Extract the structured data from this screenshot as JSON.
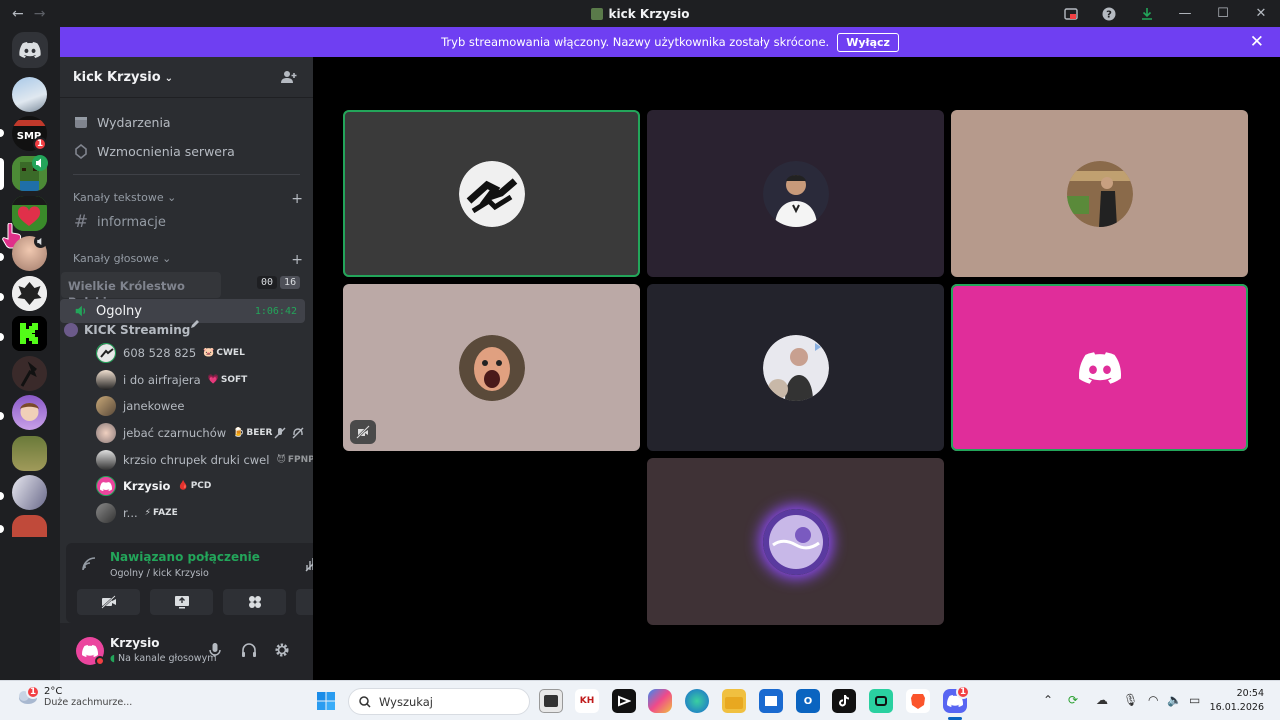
{
  "window": {
    "title": "kick Krzysio"
  },
  "banner": {
    "text": "Tryb streamowania włączony. Nazwy użytkownika zostały skrócone.",
    "button": "Wyłącz"
  },
  "rail": {
    "badges": [
      "1"
    ]
  },
  "server": {
    "name": "kick Krzysio",
    "menu": [
      "Wydarzenia",
      "Wzmocnienia serwera"
    ],
    "text_category": "Kanały tekstowe",
    "text_channels": [
      "informacje"
    ],
    "voice_category": "Kanały głosowe",
    "drag_ghost_title": "Wielkie Królestwo Polskie",
    "drag_ghost_subtitle": "KICK Streaming",
    "counter_a": "00",
    "counter_b": "16",
    "voice_channel": {
      "name": "Ogolny",
      "time": "1:06:42"
    },
    "voice_users": [
      {
        "name": "608 528 825",
        "tag": "CWEL",
        "tag_icon": "🐷"
      },
      {
        "name": "i do airfrajera",
        "tag": "SOFT",
        "tag_icon": "💗"
      },
      {
        "name": "janekowee",
        "tag": "",
        "tag_icon": ""
      },
      {
        "name": "jebać czarnuchów",
        "tag": "BEER",
        "tag_icon": "🍺"
      },
      {
        "name": "krzsio chrupek druki cwel",
        "tag": "FPNP",
        "tag_icon": "😈"
      },
      {
        "name": "Krzysio",
        "tag": "PCD",
        "tag_icon": "🩸"
      },
      {
        "name": "r...",
        "tag": "FAZE",
        "tag_icon": "⚡"
      }
    ]
  },
  "voice_panel": {
    "status": "Nawiązano połączenie",
    "location": "Ogolny / kick Krzysio"
  },
  "user": {
    "name": "Krzysio",
    "status": "Na kanale głosowym"
  },
  "colors": {
    "banner": "#6f3ff2",
    "connected": "#23a55a",
    "discord_tile": "#e02d9a",
    "panel": "#2b2d31",
    "rail": "#1e1f22"
  },
  "taskbar": {
    "temp": "2°C",
    "weather": "Duże zachmurze...",
    "weather_badge": "1",
    "search_placeholder": "Wyszukaj",
    "app_labels": [
      "KH"
    ],
    "discord_badge": "1",
    "time": "20:54",
    "date": "16.01.2026"
  }
}
